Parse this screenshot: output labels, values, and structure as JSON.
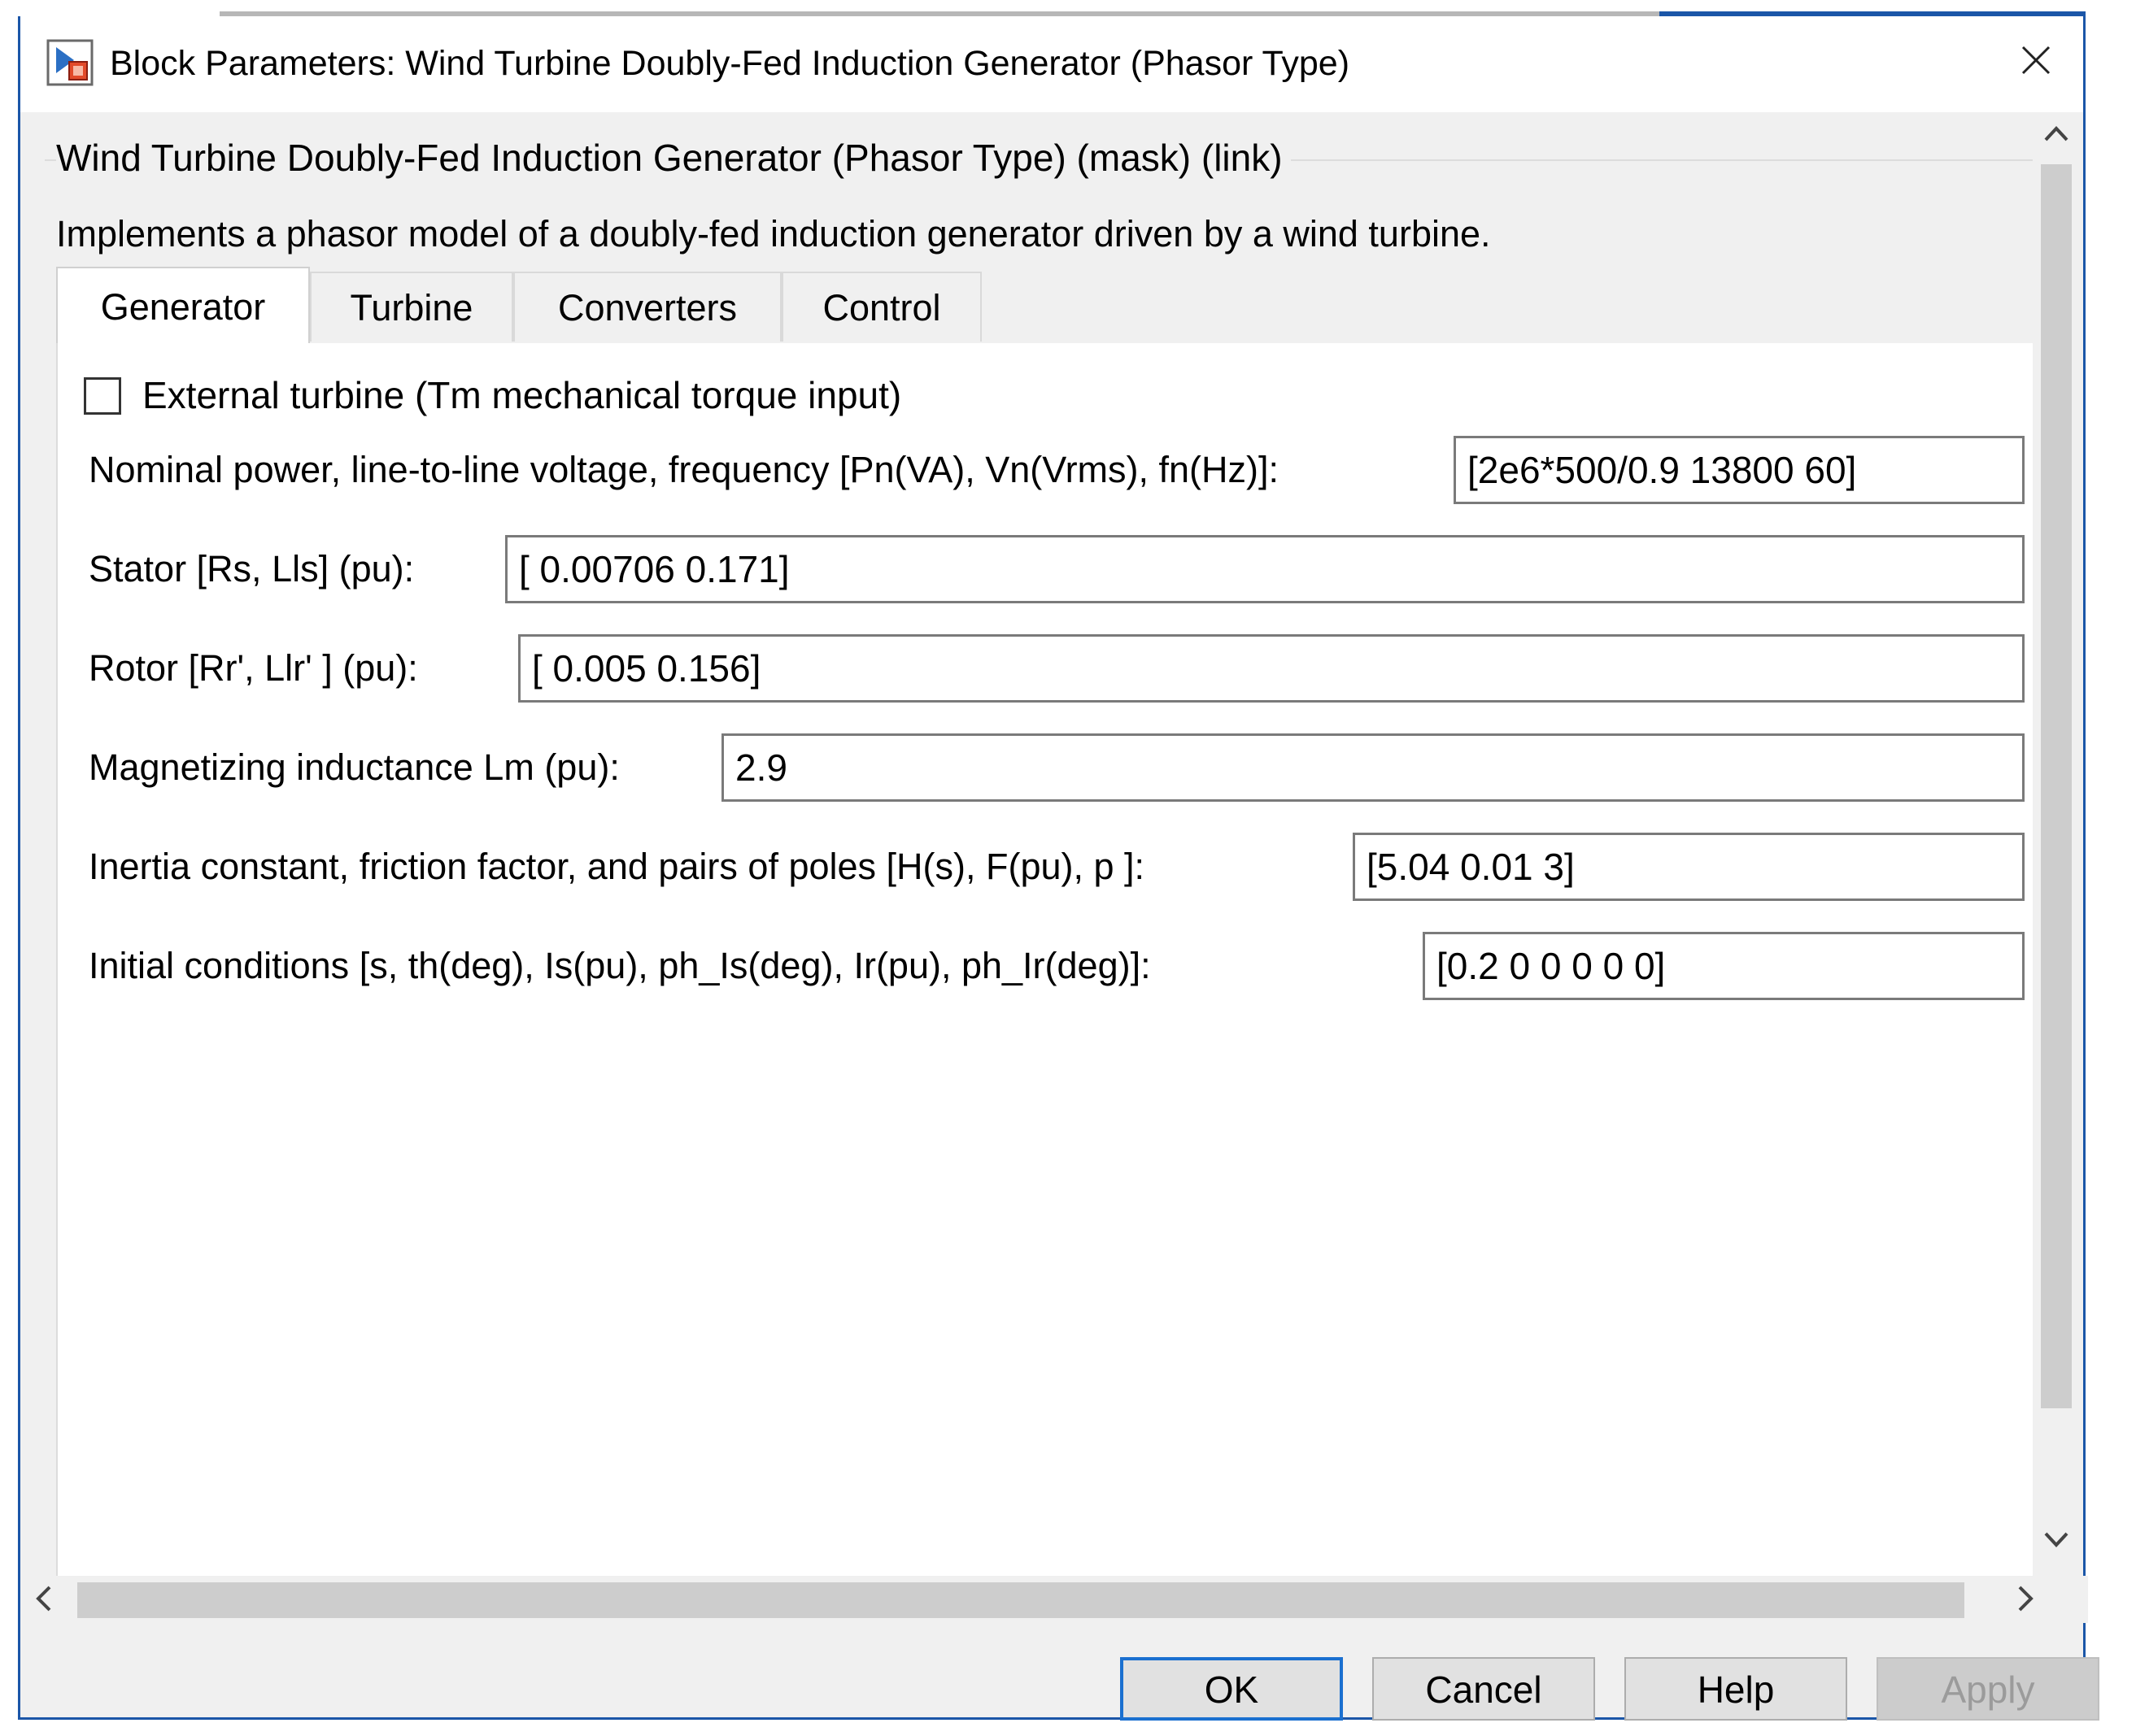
{
  "window": {
    "title": "Block Parameters: Wind Turbine Doubly-Fed Induction Generator (Phasor Type)"
  },
  "block": {
    "name": "Wind Turbine Doubly-Fed Induction Generator (Phasor Type) (mask) (link)",
    "description": "Implements a phasor model of a doubly-fed induction generator driven by a wind turbine."
  },
  "tabs": [
    "Generator",
    "Turbine",
    "Converters",
    "Control"
  ],
  "active_tab": "Generator",
  "external_turbine": {
    "label": "External turbine (Tm mechanical torque input)",
    "checked": false
  },
  "params": [
    {
      "label": "Nominal power, line-to-line voltage, frequency [Pn(VA), Vn(Vrms), fn(Hz)]:",
      "value": "[2e6*500/0.9 13800 60]"
    },
    {
      "label": "Stator [Rs, Lls] (pu):",
      "value": "[ 0.00706 0.171]"
    },
    {
      "label": "Rotor [Rr', Llr' ] (pu):",
      "value": "[ 0.005 0.156]"
    },
    {
      "label": "Magnetizing inductance Lm (pu):",
      "value": "2.9"
    },
    {
      "label": "Inertia constant, friction factor, and pairs of poles [H(s), F(pu),  p ]:",
      "value": "[5.04 0.01 3]"
    },
    {
      "label": "Initial conditions [s,  th(deg),  Is(pu), ph_Is(deg),  Ir(pu),  ph_Ir(deg)]:",
      "value": "[0.2 0 0 0 0 0]"
    }
  ],
  "buttons": {
    "ok": "OK",
    "cancel": "Cancel",
    "help": "Help",
    "apply": "Apply"
  },
  "colors": {
    "accent": "#1b56a8",
    "primary_button_border": "#1b70d0",
    "disabled_text": "#9b9b9b"
  },
  "icons": {
    "app": "simulink-block-icon",
    "close": "close-icon",
    "more": "vertical-dots-icon",
    "scroll_up": "chevron-up-icon",
    "scroll_down": "chevron-down-icon",
    "scroll_left": "chevron-left-icon",
    "scroll_right": "chevron-right-icon"
  }
}
